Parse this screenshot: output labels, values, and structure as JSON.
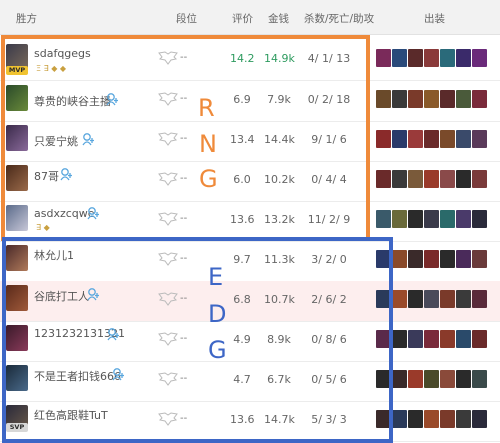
{
  "header": {
    "team": "胜方",
    "rank": "段位",
    "score": "评价",
    "gold": "金钱",
    "kda": "杀数/死亡/助攻",
    "items": "出装"
  },
  "team_rng": {
    "label_letters": [
      "R",
      "N",
      "G"
    ],
    "players": [
      {
        "name": "sdafqgegs",
        "badge": "MVP",
        "badges": "Ξ ∃ ◆ ◆",
        "rank": "--",
        "score": "14.2",
        "gold": "14.9k",
        "kda": "4/ 1/ 13"
      },
      {
        "name": "尊贵的峡谷主播",
        "rank": "--",
        "score": "6.9",
        "gold": "7.9k",
        "kda": "0/ 2/ 18"
      },
      {
        "name": "只爱宁姚",
        "rank": "--",
        "score": "13.4",
        "gold": "14.4k",
        "kda": "9/ 1/ 6"
      },
      {
        "name": "87哥",
        "rank": "--",
        "score": "6.0",
        "gold": "10.2k",
        "kda": "0/ 4/ 4"
      },
      {
        "name": "asdxzcqwe",
        "badges": "∃ ◆",
        "rank": "--",
        "score": "13.6",
        "gold": "13.2k",
        "kda": "11/ 2/ 9"
      }
    ]
  },
  "team_edg": {
    "label_letters": [
      "E",
      "D",
      "G"
    ],
    "players": [
      {
        "name": "林允儿1",
        "rank": "--",
        "score": "9.7",
        "gold": "11.3k",
        "kda": "3/ 2/ 0"
      },
      {
        "name": "谷底打工人",
        "rank": "--",
        "score": "6.8",
        "gold": "10.7k",
        "kda": "2/ 6/ 2"
      },
      {
        "name": "1231232131321",
        "rank": "--",
        "score": "4.9",
        "gold": "8.9k",
        "kda": "0/ 8/ 6"
      },
      {
        "name": "不是王者扣钱666",
        "rank": "--",
        "score": "4.7",
        "gold": "6.7k",
        "kda": "0/ 5/ 6"
      },
      {
        "name": "红色高跟鞋TuT",
        "badge": "SVP",
        "rank": "--",
        "score": "13.6",
        "gold": "14.7k",
        "kda": "5/ 3/ 3"
      }
    ]
  },
  "colors": {
    "rng_box": "#ef8a3a",
    "edg_box": "#3d66c6",
    "highlight_score": "#2e9b5f",
    "follow_icon": "#5aa7de"
  }
}
